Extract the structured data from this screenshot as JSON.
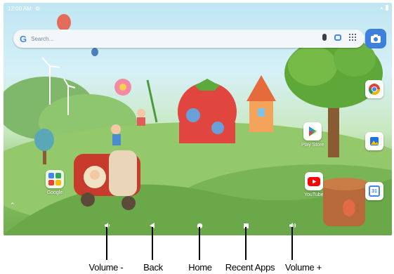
{
  "status_bar": {
    "time": "12:00 AM",
    "settings_icon": "gear-icon",
    "right_icons": [
      "wifi-icon",
      "battery-icon"
    ]
  },
  "search": {
    "placeholder": "Search...",
    "logo": "G",
    "icons": [
      "mic-icon",
      "lens-icon",
      "apps-grid-icon"
    ]
  },
  "camera_app": {
    "icon": "camera-icon"
  },
  "apps": {
    "google_folder": "Google",
    "play_store": "Play Store",
    "youtube": "YouTube",
    "chrome": {
      "icon": "chrome-icon"
    },
    "gallery": {
      "icon": "gallery-icon"
    },
    "calendar": {
      "icon": "calendar-icon",
      "day": "31"
    }
  },
  "nav_bar": {
    "buttons": [
      "volume-down",
      "back",
      "home",
      "recent-apps",
      "volume-up"
    ]
  },
  "captions": {
    "volume_down": "Volume -",
    "back": "Back",
    "home": "Home",
    "recent_apps": "Recent Apps",
    "volume_up": "Volume +"
  },
  "colors": {
    "camera": "#3f7fdc",
    "youtube": "#ff0000",
    "sky": "#bfe6f3",
    "grass": "#6fae4c"
  }
}
